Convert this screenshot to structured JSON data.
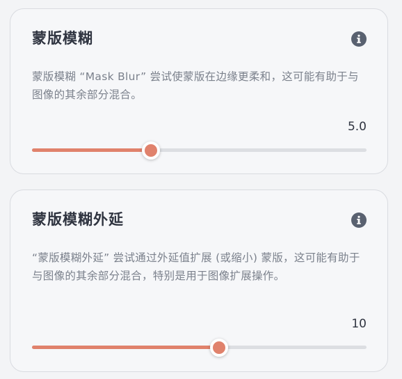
{
  "colors": {
    "accent": "#e0826c",
    "track": "#dcdee2",
    "title_text": "#2f3440",
    "desc_text": "#7b818c",
    "card_bg": "#f6f7f9"
  },
  "mask_blur": {
    "title": "蒙版模糊",
    "info_icon": "info-circle-icon",
    "description": "蒙版模糊 “Mask Blur” 尝试使蒙版在边缘更柔和，这可能有助于与图像的其余部分混合。",
    "value_label": "5.0",
    "slider": {
      "value": 5.0,
      "fraction": 0.355
    }
  },
  "mask_blur_offset": {
    "title": "蒙版模糊外延",
    "info_icon": "info-circle-icon",
    "description": "“蒙版模糊外延” 尝试通过外延值扩展 (或缩小) 蒙版，这可能有助于与图像的其余部分混合，特别是用于图像扩展操作。",
    "value_label": "10",
    "slider": {
      "value": 10,
      "fraction": 0.56
    }
  }
}
